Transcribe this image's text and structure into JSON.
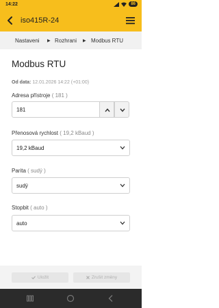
{
  "status_bar": {
    "time": "14:22",
    "battery": "86"
  },
  "app_bar": {
    "title": "iso415R-24"
  },
  "breadcrumb": {
    "items": [
      "Nastaveni",
      "Rozhrani",
      "Modbus RTU"
    ]
  },
  "page": {
    "title": "Modbus RTU",
    "since_label": "Od data:",
    "since_value": "12.01.2026 14:22 (+01:00)"
  },
  "fields": {
    "address": {
      "label": "Adresa přístroje",
      "hint": "( 181 )",
      "value": "181"
    },
    "baud": {
      "label": "Přenosová rychlost",
      "hint": "( 19,2 kBaud )",
      "value": "19,2 kBaud"
    },
    "parity": {
      "label": "Parita",
      "hint": "( sudý )",
      "value": "sudý"
    },
    "stopbit": {
      "label": "Stopbit",
      "hint": "( auto )",
      "value": "auto"
    }
  },
  "footer": {
    "save_label": "Uložit",
    "cancel_label": "Zrušit změny"
  },
  "colors": {
    "accent": "#f7be1c",
    "breadcrumb_bg": "#f1f1f1",
    "nav_bg": "#2b2b2b"
  },
  "icons": [
    "back-arrow-icon",
    "hamburger-menu-icon",
    "chevron-right-icon",
    "chevron-up-icon",
    "chevron-down-icon",
    "check-icon",
    "x-icon",
    "recents-icon",
    "home-icon",
    "back-icon"
  ]
}
